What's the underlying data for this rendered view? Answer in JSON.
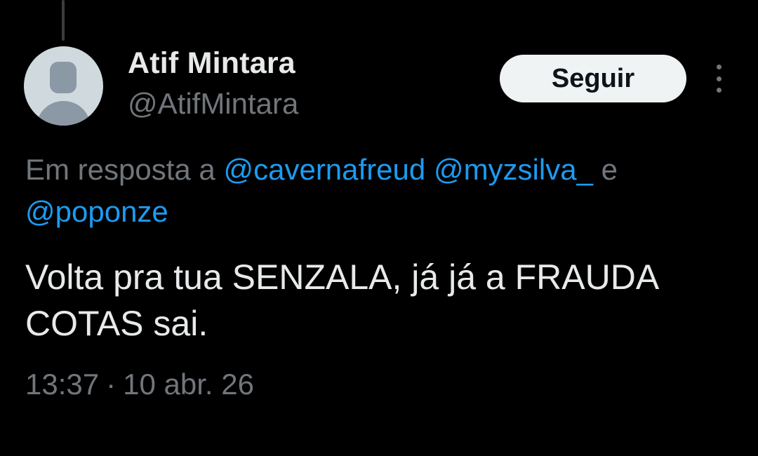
{
  "tweet": {
    "author": {
      "display_name": "Atif Mintara",
      "handle": "@AtifMintara"
    },
    "follow_label": "Seguir",
    "reply_context": {
      "prefix": "Em resposta a",
      "mentions": [
        "@cavernafreud",
        "@myzsilva_",
        "@poponze"
      ],
      "conjunction": "e"
    },
    "text_lines": [
      "Volta pra tua SENZALA, já já a FRAUDA",
      "COTAS sai."
    ],
    "time": "13:37",
    "separator": "·",
    "date": "10 abr. 26"
  },
  "icons": {
    "avatar": "default-avatar-icon",
    "more": "more-options-icon"
  },
  "colors": {
    "background": "#000000",
    "primary_text": "#e7e9ea",
    "secondary_text": "#71767b",
    "link": "#1d9bf0",
    "button_bg": "#eff3f4"
  }
}
